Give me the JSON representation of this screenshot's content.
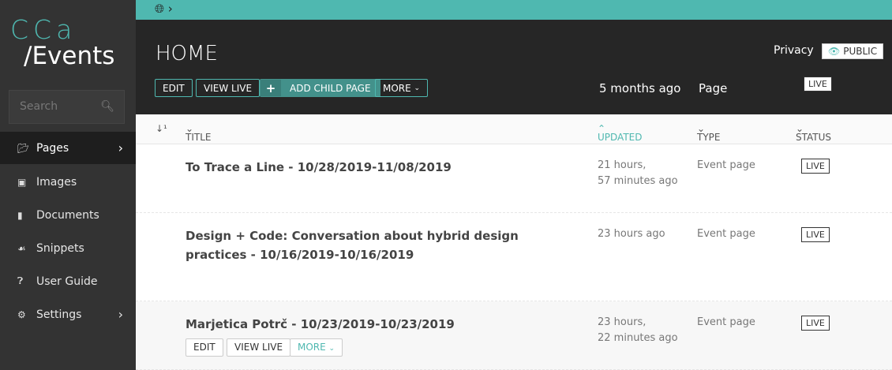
{
  "logo": {
    "top": "CCa",
    "bottom": "/Events"
  },
  "search": {
    "placeholder": "Search"
  },
  "sidebar": {
    "items": [
      {
        "label": "Pages",
        "icon": "folder-open-icon"
      },
      {
        "label": "Images",
        "icon": "image-icon"
      },
      {
        "label": "Documents",
        "icon": "document-icon"
      },
      {
        "label": "Snippets",
        "icon": "snippet-icon"
      },
      {
        "label": "User Guide",
        "icon": "help-icon"
      },
      {
        "label": "Settings",
        "icon": "cogs-icon"
      }
    ]
  },
  "header": {
    "title": "HOME",
    "edit": "EDIT",
    "view_live": "VIEW LIVE",
    "add_child": "ADD CHILD PAGE",
    "more": "MORE",
    "updated": "5 months ago",
    "type": "Page",
    "status": "LIVE",
    "privacy_label": "Privacy",
    "privacy_value": "PUBLIC"
  },
  "table": {
    "columns": {
      "title": "TITLE",
      "updated": "UPDATED",
      "type": "TYPE",
      "status": "STATUS"
    },
    "rows": [
      {
        "title": "To Trace a Line - 10/28/2019-11/08/2019",
        "updated1": "21 hours,",
        "updated2": "57 minutes ago",
        "type": "Event page",
        "status": "LIVE"
      },
      {
        "title": "Design + Code: Conversation about hybrid design practices - 10/16/2019-10/16/2019",
        "updated1": "23 hours ago",
        "type": "Event page",
        "status": "LIVE"
      },
      {
        "title": "Marjetica Potrč - 10/23/2019-10/23/2019",
        "updated1": "23 hours,",
        "updated2": "22 minutes ago",
        "type": "Event page",
        "status": "LIVE",
        "actions": {
          "edit": "EDIT",
          "view_live": "VIEW LIVE",
          "more": "MORE"
        }
      }
    ]
  }
}
